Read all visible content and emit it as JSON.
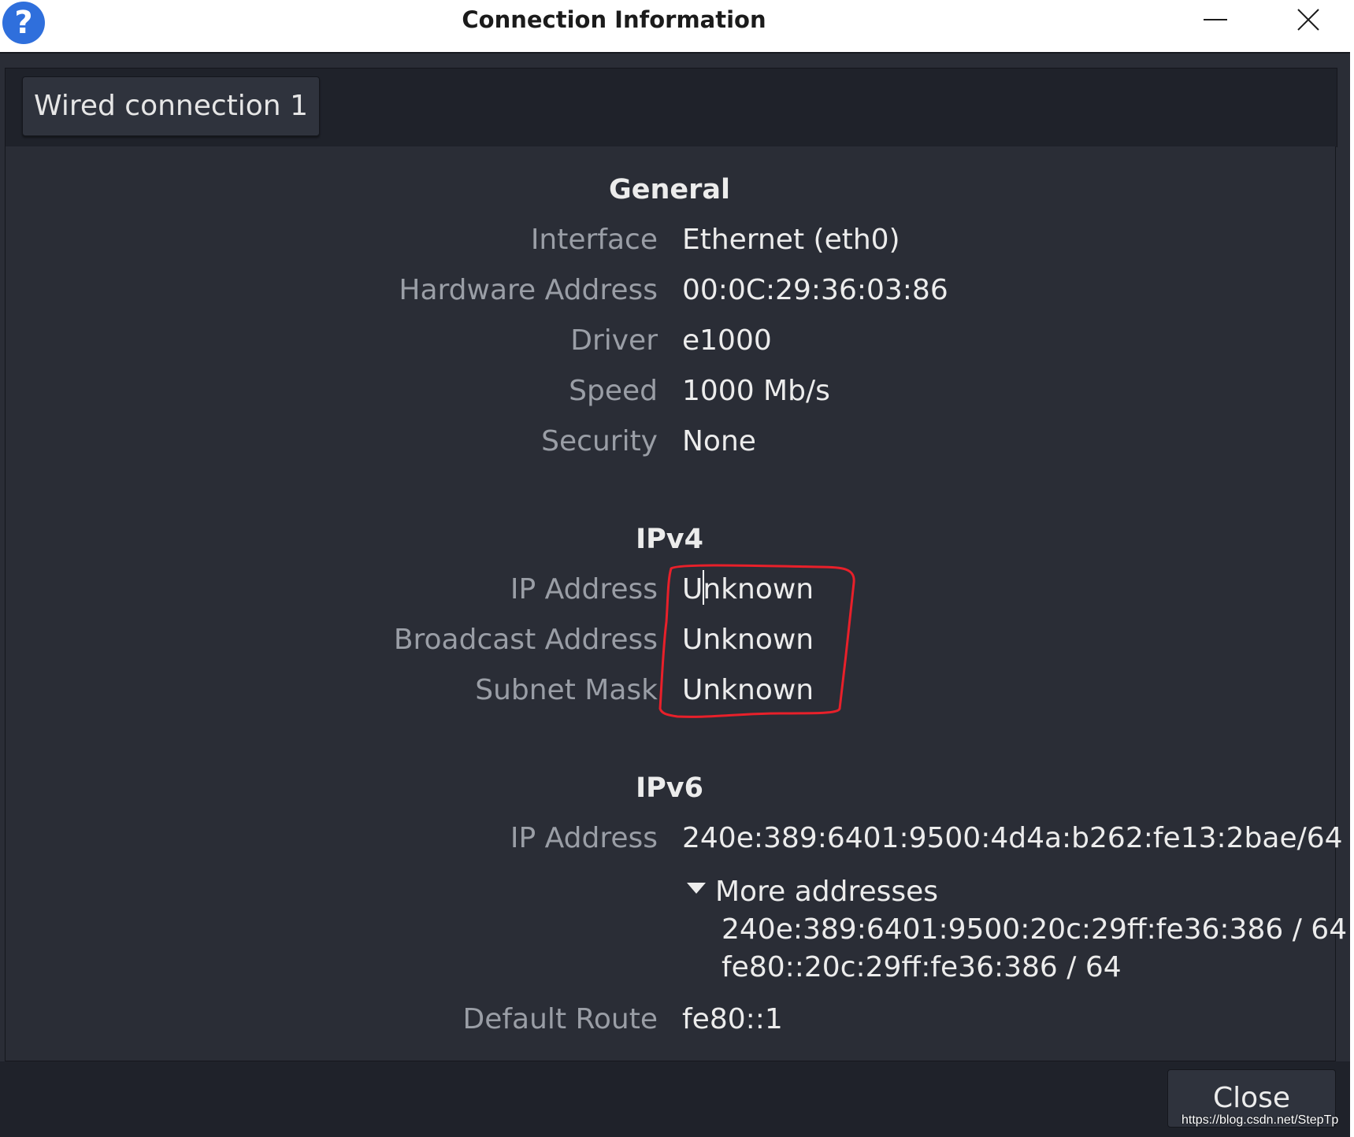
{
  "window": {
    "title": "Connection Information",
    "help_icon_glyph": "?"
  },
  "tabs": [
    {
      "label": "Wired connection 1"
    }
  ],
  "general": {
    "title": "General",
    "rows": [
      {
        "label": "Interface",
        "value": "Ethernet (eth0)"
      },
      {
        "label": "Hardware Address",
        "value": "00:0C:29:36:03:86"
      },
      {
        "label": "Driver",
        "value": "e1000"
      },
      {
        "label": "Speed",
        "value": "1000 Mb/s"
      },
      {
        "label": "Security",
        "value": "None"
      }
    ]
  },
  "ipv4": {
    "title": "IPv4",
    "rows": [
      {
        "label": "IP Address",
        "value": "Unknown"
      },
      {
        "label": "Broadcast Address",
        "value": "Unknown"
      },
      {
        "label": "Subnet Mask",
        "value": "Unknown"
      }
    ]
  },
  "ipv6": {
    "title": "IPv6",
    "ip_label": "IP Address",
    "ip_value": "240e:389:6401:9500:4d4a:b262:fe13:2bae/64",
    "more_label": "More addresses",
    "more_addresses": [
      "240e:389:6401:9500:20c:29ff:fe36:386 / 64",
      "fe80::20c:29ff:fe36:386 / 64"
    ],
    "route_label": "Default Route",
    "route_value": "fe80::1"
  },
  "footer": {
    "close_label": "Close"
  },
  "watermark": "https://blog.csdn.net/StepTp",
  "colors": {
    "background": "#2a2d36",
    "label": "#9a9ea6",
    "value": "#ececec",
    "annotation": "#e8202a",
    "help_icon": "#2f6fdc"
  }
}
